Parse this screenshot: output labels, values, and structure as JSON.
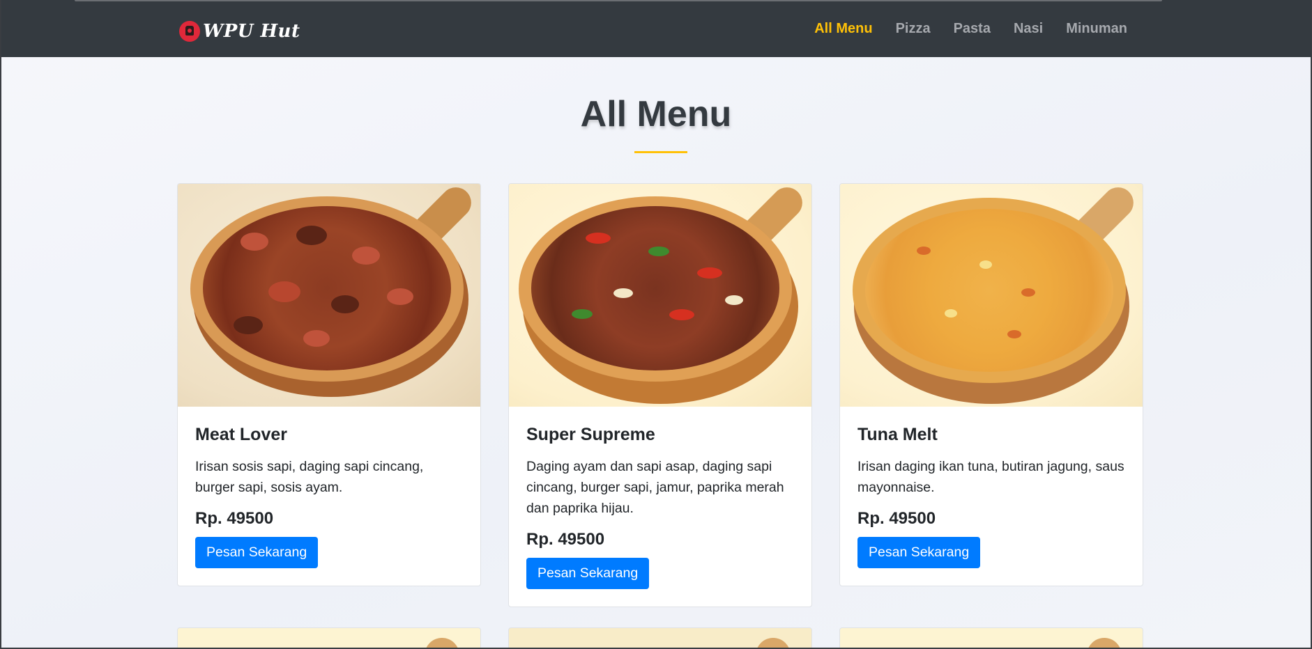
{
  "navbar": {
    "brand": "WPU Hut",
    "links": [
      "All Menu",
      "Pizza",
      "Pasta",
      "Nasi",
      "Minuman"
    ],
    "active": "All Menu"
  },
  "heading": "All Menu",
  "colors": {
    "navbar_bg": "#343a40",
    "accent": "#ffc107",
    "button": "#007bff"
  },
  "menu": [
    {
      "name": "Meat Lover",
      "description": "Irisan sosis sapi, daging sapi cincang, burger sapi, sosis ayam.",
      "price": "Rp. 49500",
      "button": "Pesan Sekarang"
    },
    {
      "name": "Super Supreme",
      "description": "Daging ayam dan sapi asap, daging sapi cincang, burger sapi, jamur, paprika merah dan paprika hijau.",
      "price": "Rp. 49500",
      "button": "Pesan Sekarang"
    },
    {
      "name": "Tuna Melt",
      "description": "Irisan daging ikan tuna, butiran jagung, saus mayonnaise.",
      "price": "Rp. 49500",
      "button": "Pesan Sekarang"
    }
  ]
}
